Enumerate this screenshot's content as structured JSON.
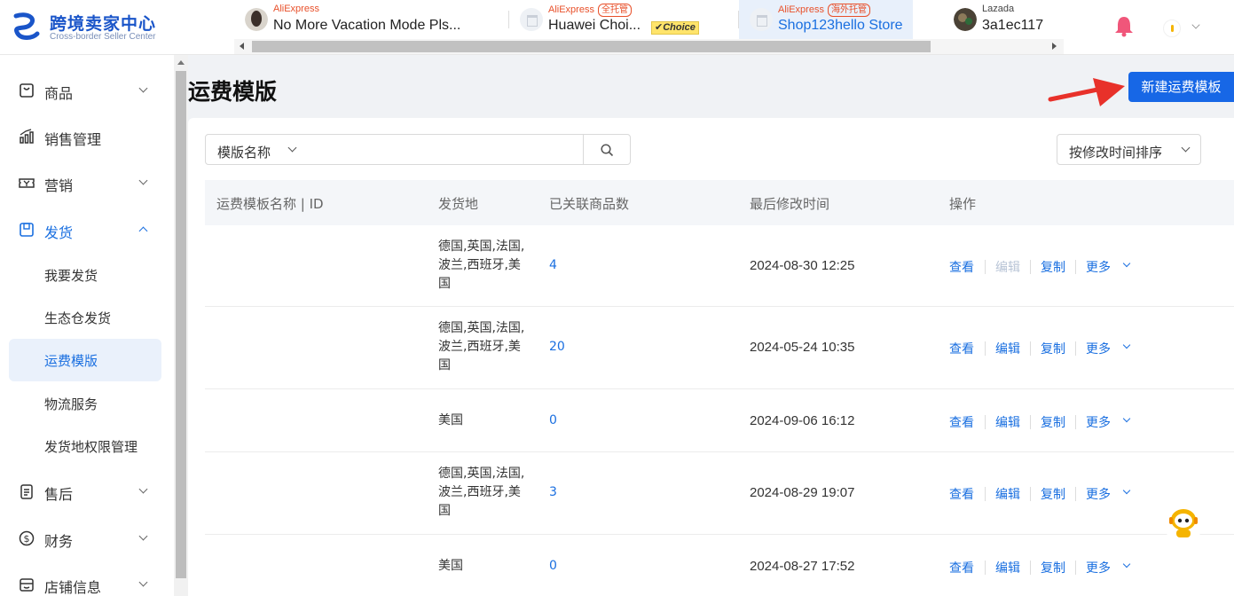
{
  "logo": {
    "title": "跨境卖家中心",
    "subtitle": "Cross-border Seller Center"
  },
  "shops": [
    {
      "platform": "AliExpress",
      "tag": "",
      "name": "No More Vacation Mode Pls...",
      "badge": ""
    },
    {
      "platform": "AliExpress",
      "tag": "全托管",
      "name": "Huawei Choi...",
      "badge": "Choice"
    },
    {
      "platform": "AliExpress",
      "tag": "海外托管",
      "name": "Shop123hello Store",
      "badge": ""
    },
    {
      "platform": "Lazada",
      "tag": "",
      "name": "3a1ec117",
      "badge": ""
    }
  ],
  "sidebar": {
    "items": [
      {
        "label": "商品",
        "icon": "product-icon"
      },
      {
        "label": "销售管理",
        "icon": "chart-icon"
      },
      {
        "label": "营销",
        "icon": "ticket-icon"
      },
      {
        "label": "发货",
        "icon": "box-icon"
      },
      {
        "label": "售后",
        "icon": "clipboard-icon"
      },
      {
        "label": "财务",
        "icon": "dollar-icon"
      },
      {
        "label": "店铺信息",
        "icon": "store-icon"
      }
    ],
    "sub_items": [
      {
        "label": "我要发货"
      },
      {
        "label": "生态仓发货"
      },
      {
        "label": "运费模版"
      },
      {
        "label": "物流服务"
      },
      {
        "label": "发货地权限管理"
      }
    ]
  },
  "page": {
    "title": "运费模版",
    "new_button": "新建运费模板"
  },
  "filters": {
    "field_select": "模版名称",
    "search_placeholder": "",
    "sort_select": "按修改时间排序"
  },
  "table": {
    "headers": [
      "运费模板名称 | ID",
      "发货地",
      "已关联商品数",
      "最后修改时间",
      "操作"
    ],
    "rows": [
      {
        "origin": "德国,英国,法国,波兰,西班牙,美国",
        "count": "4",
        "modified": "2024-08-30 12:25",
        "edit_disabled": true
      },
      {
        "origin": "德国,英国,法国,波兰,西班牙,美国",
        "count": "20",
        "modified": "2024-05-24 10:35",
        "edit_disabled": false
      },
      {
        "origin": "美国",
        "count": "0",
        "modified": "2024-09-06 16:12",
        "edit_disabled": false
      },
      {
        "origin": "德国,英国,法国,波兰,西班牙,美国",
        "count": "3",
        "modified": "2024-08-29 19:07",
        "edit_disabled": false
      },
      {
        "origin": "美国",
        "count": "0",
        "modified": "2024-08-27 17:52",
        "edit_disabled": false
      }
    ],
    "actions": {
      "view": "查看",
      "edit": "编辑",
      "copy": "复制",
      "more": "更多"
    }
  },
  "colors": {
    "primary": "#1767e6",
    "link": "#1a6fe0",
    "accent_red": "#e8502a",
    "annotation_arrow": "#e8312a"
  }
}
